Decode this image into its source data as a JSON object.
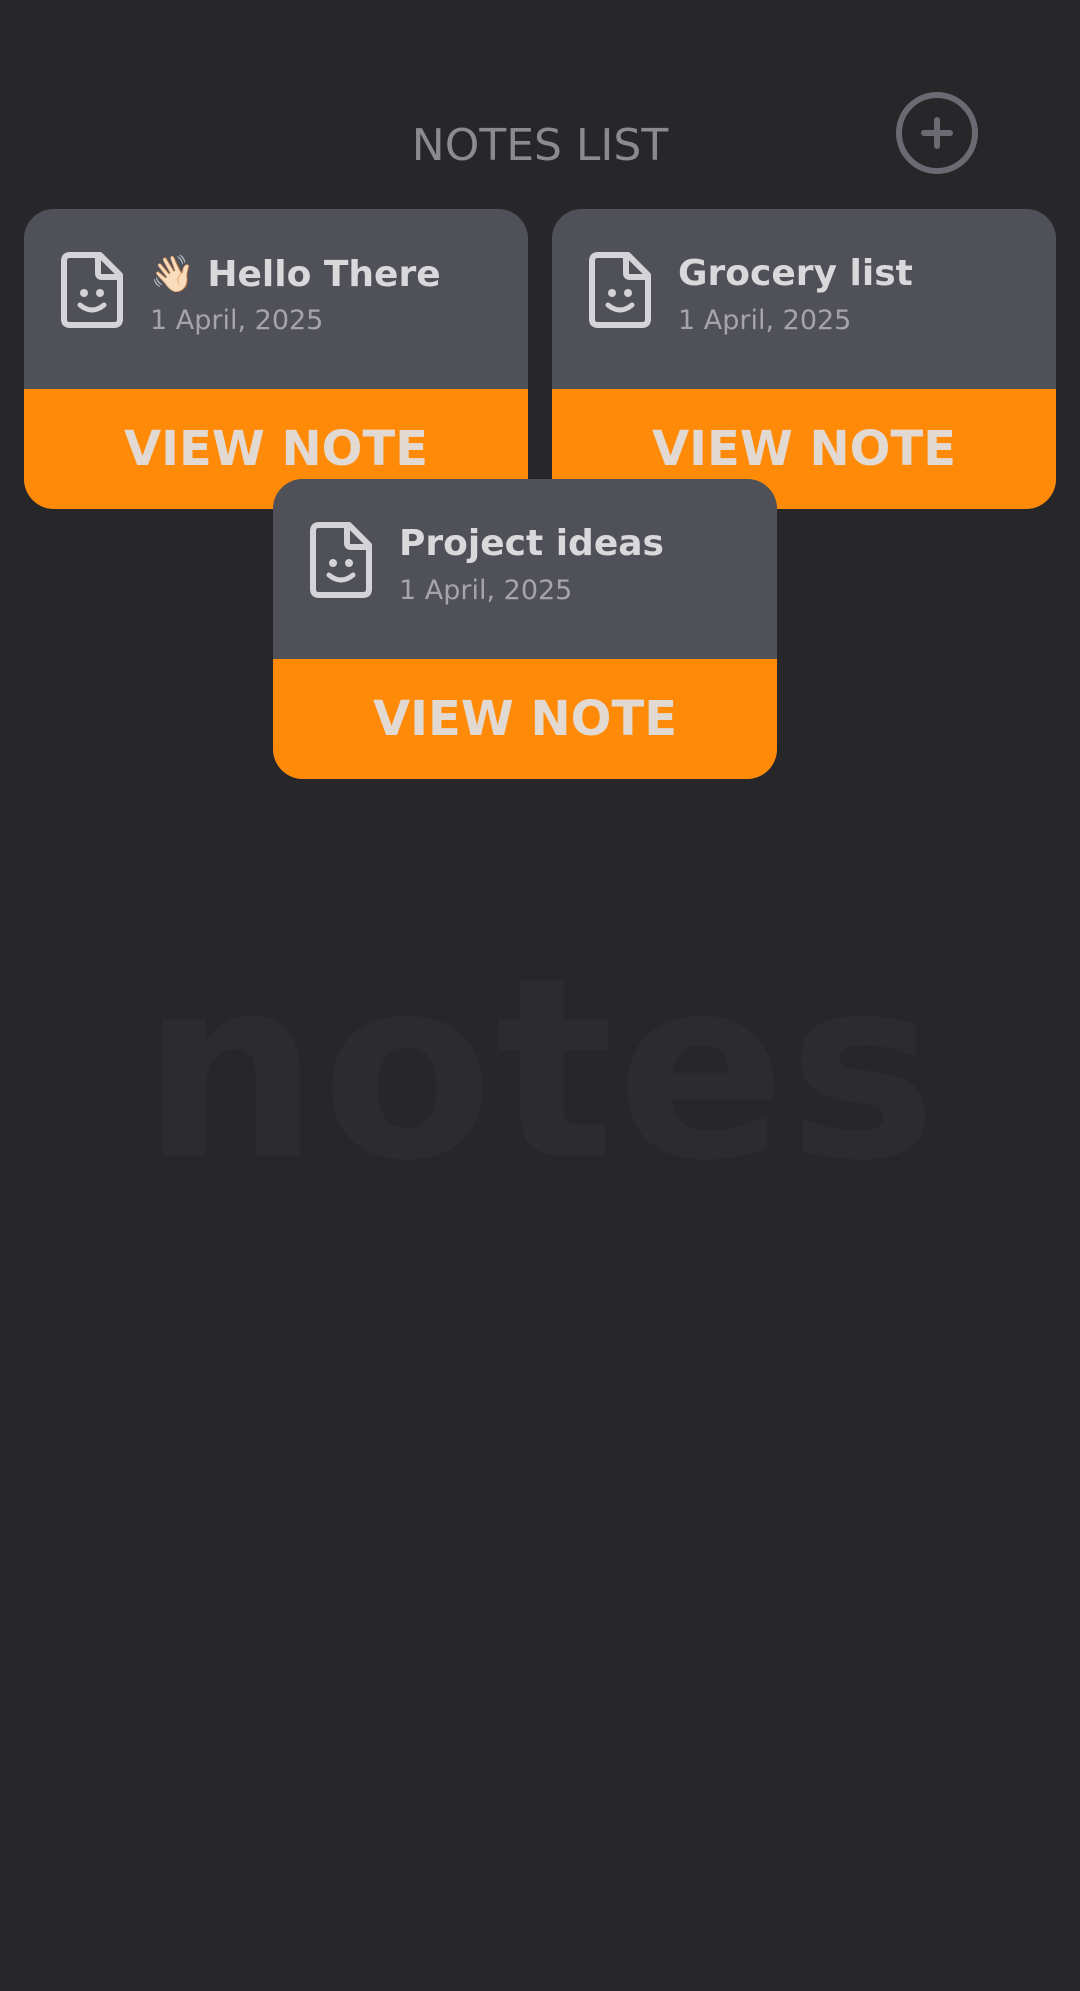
{
  "header": {
    "title": "NOTES LIST",
    "add_icon": "plus-circle-icon"
  },
  "watermark": "notes",
  "colors": {
    "background": "#272729",
    "card": "#505059",
    "accent": "#ff8a08"
  },
  "notes": [
    {
      "title": "👋🏻 Hello There",
      "date": "1 April, 2025",
      "button_label": "VIEW NOTE",
      "icon": "smiley-document-icon"
    },
    {
      "title": "Grocery list",
      "date": "1 April, 2025",
      "button_label": "VIEW NOTE",
      "icon": "smiley-document-icon"
    },
    {
      "title": "Project ideas",
      "date": "1 April, 2025",
      "button_label": "VIEW NOTE",
      "icon": "smiley-document-icon"
    }
  ]
}
